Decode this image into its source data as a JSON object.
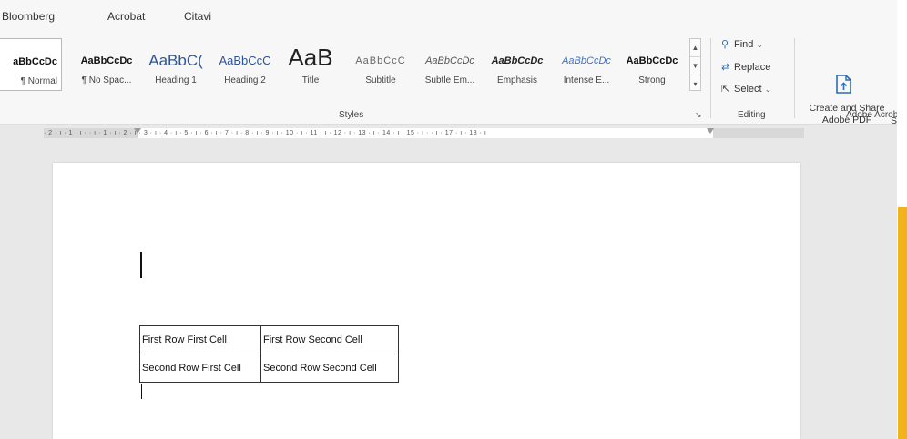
{
  "menu": [
    "Bloomberg",
    "Acrobat",
    "Citavi"
  ],
  "styles": {
    "group_label": "Styles",
    "tiles": [
      {
        "preview": "aBbCcDc",
        "name": "¶ Normal"
      },
      {
        "preview": "AaBbCcDc",
        "name": "¶ No Spac..."
      },
      {
        "preview": "AaBbC(",
        "name": "Heading 1"
      },
      {
        "preview": "AaBbCcC",
        "name": "Heading 2"
      },
      {
        "preview": "AaB",
        "name": "Title"
      },
      {
        "preview": "AaBbCcC",
        "name": "Subtitle"
      },
      {
        "preview": "AaBbCcDc",
        "name": "Subtle Em..."
      },
      {
        "preview": "AaBbCcDc",
        "name": "Emphasis"
      },
      {
        "preview": "AaBbCcDc",
        "name": "Intense E..."
      },
      {
        "preview": "AaBbCcDc",
        "name": "Strong"
      }
    ]
  },
  "editing": {
    "group_label": "Editing",
    "find": "Find",
    "replace": "Replace",
    "select": "Select"
  },
  "acrobat": {
    "group_label": "Adobe Acrob",
    "create_share": "Create and Share Adobe PDF",
    "partial": "S"
  },
  "ruler": {
    "text": "· 2 · ı · 1 · ı ·  · ı · 1 · ı · 2 · ı · 3 · ı · 4 · ı · 5 · ı · 6 · ı · 7 · ı · 8 · ı · 9 · ı · 10 · ı · 11 · ı · 12 · ı · 13 · ı · 14 · ı · 15 · ı ·  · ı · 17 · ı · 18 · ı"
  },
  "table": {
    "rows": [
      [
        "First Row First Cell",
        "First Row Second Cell"
      ],
      [
        "Second Row First Cell",
        "Second Row Second Cell"
      ]
    ]
  },
  "colors": {
    "accent": "#f2b21c",
    "heading_blue": "#2f5597",
    "link_blue": "#4472c4"
  }
}
